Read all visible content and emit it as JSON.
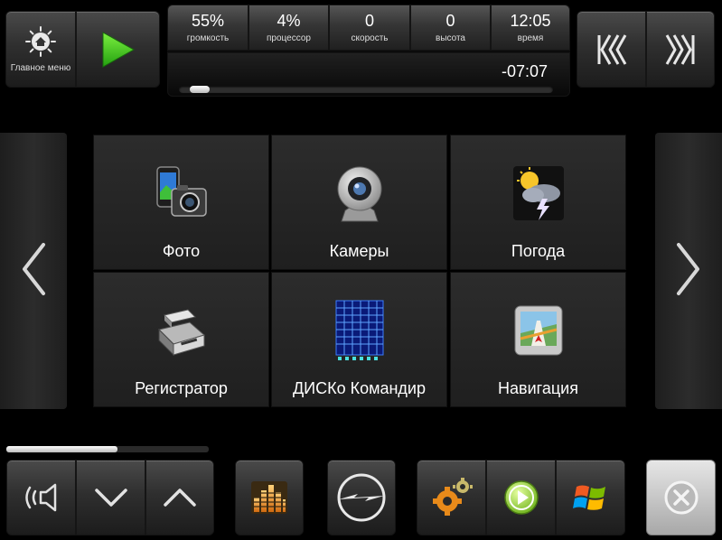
{
  "menu": {
    "label": "Главное меню"
  },
  "status": [
    {
      "value": "55%",
      "label": "громкость"
    },
    {
      "value": "4%",
      "label": "процессор"
    },
    {
      "value": "0",
      "label": "скорость"
    },
    {
      "value": "0",
      "label": "высота"
    },
    {
      "value": "12:05",
      "label": "время"
    }
  ],
  "player": {
    "time_remaining": "-07:07",
    "progress": 0.03
  },
  "volume_slider": {
    "level": 0.55
  },
  "tiles": [
    {
      "label": "Фото",
      "icon": "photo-camera-icon"
    },
    {
      "label": "Камеры",
      "icon": "webcam-icon"
    },
    {
      "label": "Погода",
      "icon": "weather-storm-icon"
    },
    {
      "label": "Регистратор",
      "icon": "dashcam-icon"
    },
    {
      "label": "ДИСКо Командир",
      "icon": "file-commander-icon"
    },
    {
      "label": "Навигация",
      "icon": "gps-navigator-icon"
    }
  ],
  "colors": {
    "accent_green": "#3cc41c",
    "background": "#000000",
    "tile": "#262626"
  }
}
